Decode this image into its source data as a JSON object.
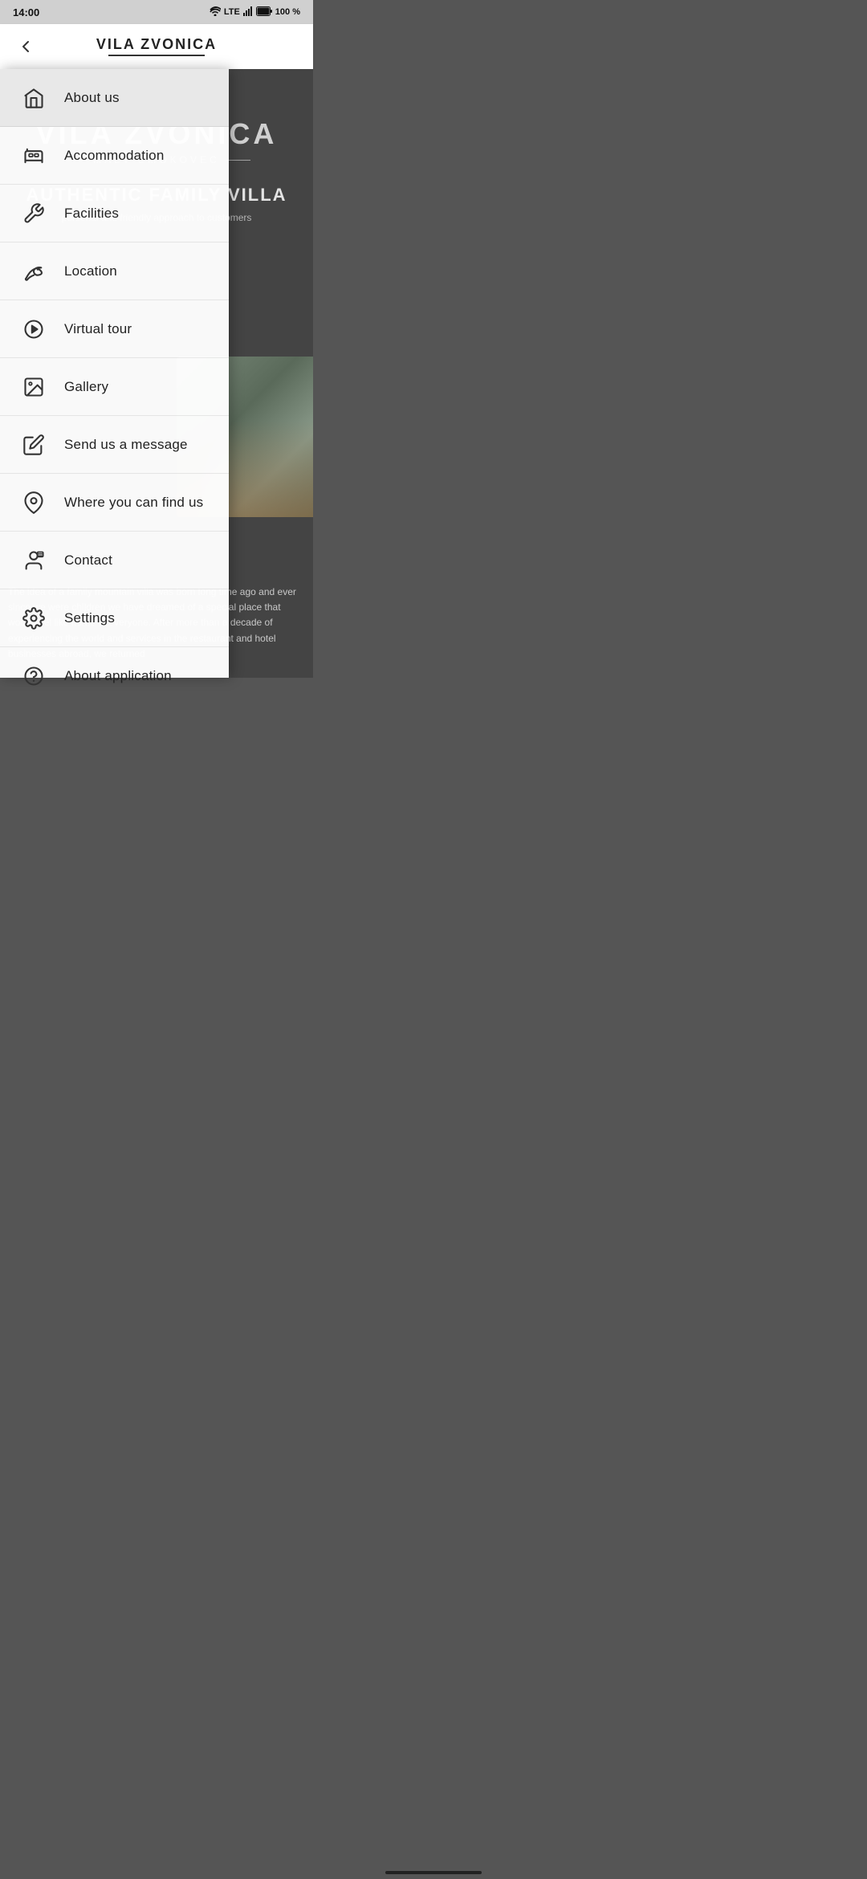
{
  "statusBar": {
    "time": "14:00",
    "wifi": "wifi",
    "network": "LTE",
    "signal": "signal",
    "battery": "100 %"
  },
  "header": {
    "logoLine1": "VILA ZVONICA",
    "backLabel": "back"
  },
  "bgContent": {
    "aboutUsLabel": "About us",
    "villaName": "VILA ZVONICA",
    "villaSub": "MALÝ SMOKOVEC",
    "headline": "AUTHENTIC FAMILY VILLA",
    "tagline": "personal and friendly approach to customers",
    "bodyText": "The idea of a family mountain villa was born long time ago and ever since we were children we have dreamed of a special place that would feel like home to everyone. After more than a decade of experiencing the world and services in the restaurant and hotel businesses abroad, we returned"
  },
  "menu": {
    "items": [
      {
        "id": "about-us",
        "label": "About us",
        "icon": "home",
        "active": true
      },
      {
        "id": "accommodation",
        "label": "Accommodation",
        "icon": "bed",
        "active": false
      },
      {
        "id": "facilities",
        "label": "Facilities",
        "icon": "tools",
        "active": false
      },
      {
        "id": "location",
        "label": "Location",
        "icon": "leaf",
        "active": false
      },
      {
        "id": "virtual-tour",
        "label": "Virtual tour",
        "icon": "play",
        "active": false
      },
      {
        "id": "gallery",
        "label": "Gallery",
        "icon": "gallery",
        "active": false
      },
      {
        "id": "send-message",
        "label": "Send us a message",
        "icon": "pencil",
        "active": false
      },
      {
        "id": "find-us",
        "label": "Where you can find us",
        "icon": "pin",
        "active": false
      },
      {
        "id": "contact",
        "label": "Contact",
        "icon": "contact",
        "active": false
      },
      {
        "id": "settings",
        "label": "Settings",
        "icon": "gear",
        "active": false
      },
      {
        "id": "about-app",
        "label": "About application",
        "icon": "question",
        "active": false
      }
    ]
  }
}
